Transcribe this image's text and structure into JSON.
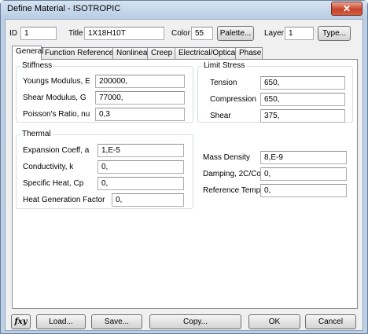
{
  "window": {
    "title": "Define Material - ISOTROPIC",
    "close_glyph": "✕"
  },
  "header": {
    "id_label": "ID",
    "id_value": "1",
    "title_label": "Title",
    "title_value": "1X18H10T",
    "color_label": "Color",
    "color_value": "55",
    "palette_button": "Palette...",
    "layer_label": "Layer",
    "layer_value": "1",
    "type_button": "Type..."
  },
  "tabs": [
    "General",
    "Function References",
    "Nonlinear",
    "Creep",
    "Electrical/Optical",
    "Phase"
  ],
  "stiffness": {
    "title": "Stiffness",
    "youngs_label": "Youngs Modulus, E",
    "youngs_value": "200000,",
    "shear_label": "Shear Modulus, G",
    "shear_value": "77000,",
    "poisson_label": "Poisson's Ratio, nu",
    "poisson_value": "0,3"
  },
  "limit_stress": {
    "title": "Limit Stress",
    "tension_label": "Tension",
    "tension_value": "650,",
    "compression_label": "Compression",
    "compression_value": "650,",
    "shear_label": "Shear",
    "shear_value": "375,"
  },
  "thermal": {
    "title": "Thermal",
    "expansion_label": "Expansion Coeff, a",
    "expansion_value": "1,E-5",
    "conductivity_label": "Conductivity, k",
    "conductivity_value": "0,",
    "specific_heat_label": "Specific Heat, Cp",
    "specific_heat_value": "0,",
    "heat_gen_label": "Heat Generation Factor",
    "heat_gen_value": "0,"
  },
  "other": {
    "mass_density_label": "Mass Density",
    "mass_density_value": "8,E-9",
    "damping_label": "Damping, 2C/Co",
    "damping_value": "0,",
    "ref_temp_label": "Reference Temp",
    "ref_temp_value": "0,"
  },
  "footer": {
    "fxy_icon": "fxy",
    "load_button": "Load...",
    "save_button": "Save...",
    "copy_button": "Copy...",
    "ok_button": "OK",
    "cancel_button": "Cancel"
  }
}
